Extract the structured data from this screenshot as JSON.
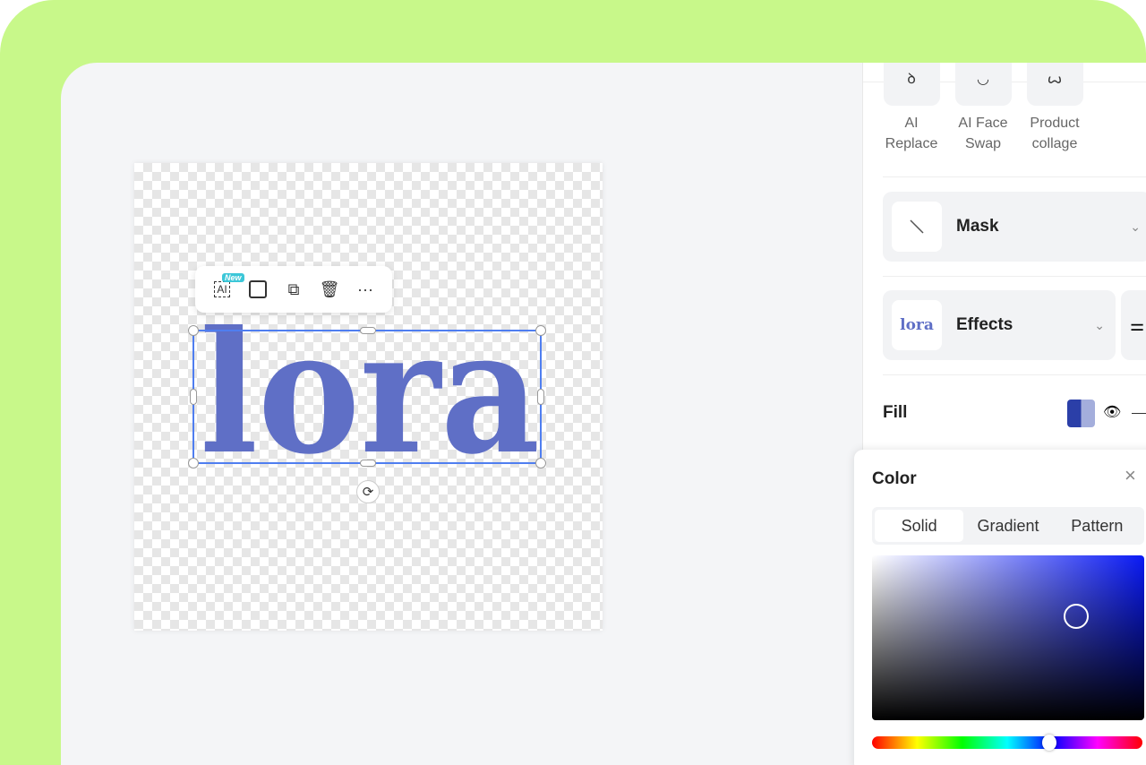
{
  "canvas": {
    "logo_text": "lora",
    "logo_color": "#5f6fc6",
    "toolbar": {
      "new_badge": "New",
      "ai_label": "AI",
      "more": "···"
    }
  },
  "panel": {
    "tools": [
      {
        "label": "AI Replace",
        "icon": "ai-replace-icon"
      },
      {
        "label": "AI Face Swap",
        "icon": "face-swap-icon"
      },
      {
        "label": "Product collage",
        "icon": "collage-icon"
      }
    ],
    "mask": {
      "label": "Mask"
    },
    "effects": {
      "label": "Effects",
      "thumb_text": "lora"
    },
    "fill": {
      "label": "Fill",
      "color": "#2b3fa8"
    }
  },
  "color_popup": {
    "title": "Color",
    "tabs": [
      "Solid",
      "Gradient",
      "Pattern"
    ],
    "active_tab": "Solid",
    "selected_hue": "#0a1af5"
  },
  "colors": {
    "background": "#c8f88a",
    "accent": "#4f7ef0"
  }
}
